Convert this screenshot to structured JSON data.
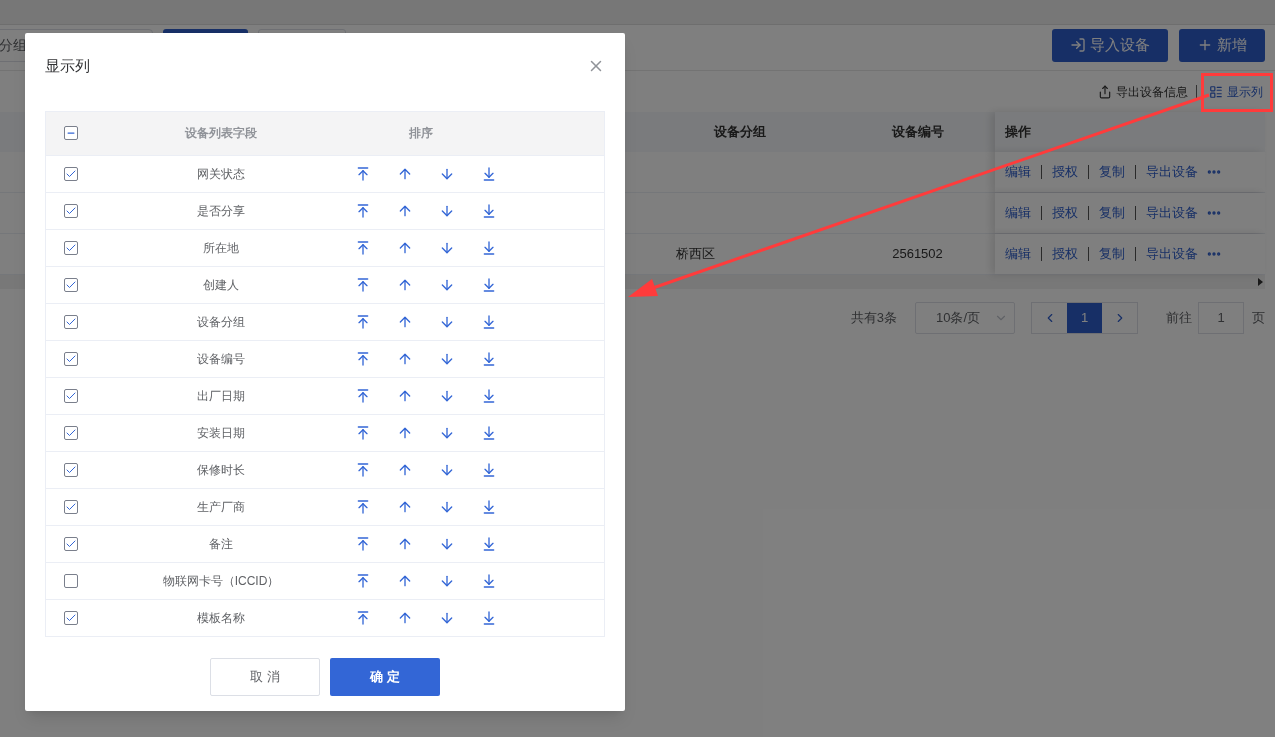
{
  "filter_bar": {
    "group_field": "分组"
  },
  "header_buttons": [
    {
      "kind": "import",
      "label": "导入设备"
    },
    {
      "kind": "add",
      "label": "新增"
    }
  ],
  "toolbar": {
    "export_label": "导出设备信息",
    "columns_label": "显示列"
  },
  "table": {
    "columns": [
      "设备分组",
      "设备编号",
      "操作"
    ],
    "rows": [
      {
        "actions": [
          "编辑",
          "授权",
          "复制",
          "导出设备"
        ]
      },
      {
        "actions": [
          "编辑",
          "授权",
          "复制",
          "导出设备"
        ]
      },
      {
        "group": "桥西区",
        "number": "2561502",
        "actions": [
          "编辑",
          "授权",
          "复制",
          "导出设备"
        ]
      }
    ]
  },
  "pagination": {
    "total": "共有3条",
    "page_size": "10条/页",
    "pages": [
      {
        "label": "1",
        "selected": true
      }
    ],
    "goto_label": "前往",
    "goto_value": "1",
    "page_unit": "页"
  },
  "dialog": {
    "title": "显示列",
    "header_checkbox": {
      "indeterminate": true
    },
    "columns": [
      "设备列表字段",
      "排序"
    ],
    "fields": [
      {
        "label": "网关状态",
        "checked": true
      },
      {
        "label": "是否分享",
        "checked": true
      },
      {
        "label": "所在地",
        "checked": true
      },
      {
        "label": "创建人",
        "checked": true
      },
      {
        "label": "设备分组",
        "checked": true
      },
      {
        "label": "设备编号",
        "checked": true
      },
      {
        "label": "出厂日期",
        "checked": true
      },
      {
        "label": "安装日期",
        "checked": true
      },
      {
        "label": "保修时长",
        "checked": true
      },
      {
        "label": "生产厂商",
        "checked": true
      },
      {
        "label": "备注",
        "checked": true
      },
      {
        "label": "物联网卡号（ICCID）",
        "checked": false
      },
      {
        "label": "模板名称",
        "checked": true
      }
    ],
    "cancel_label": "取 消",
    "confirm_label": "确 定"
  }
}
